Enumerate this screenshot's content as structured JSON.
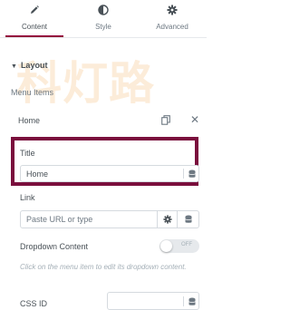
{
  "tabs": [
    {
      "label": "Content",
      "icon": "pencil-icon",
      "active": true
    },
    {
      "label": "Style",
      "icon": "half-circle-icon",
      "active": false
    },
    {
      "label": "Advanced",
      "icon": "gear-icon",
      "active": false
    }
  ],
  "watermark": "科灯路",
  "section": {
    "title": "Layout",
    "caret_icon": "caret-down-icon"
  },
  "menu_items": {
    "label": "Menu Items",
    "items": [
      {
        "name": "Home"
      }
    ]
  },
  "fields": {
    "title": {
      "label": "Title",
      "value": "Home"
    },
    "link": {
      "label": "Link",
      "placeholder": "Paste URL or type"
    },
    "dropdown": {
      "label": "Dropdown Content",
      "toggle_state": "OFF",
      "enabled": false,
      "description": "Click on the menu item to edit its dropdown content."
    },
    "css_id": {
      "label": "CSS ID",
      "value": ""
    }
  },
  "colors": {
    "accent": "#93003c",
    "highlight_border": "#7a0f3d"
  }
}
